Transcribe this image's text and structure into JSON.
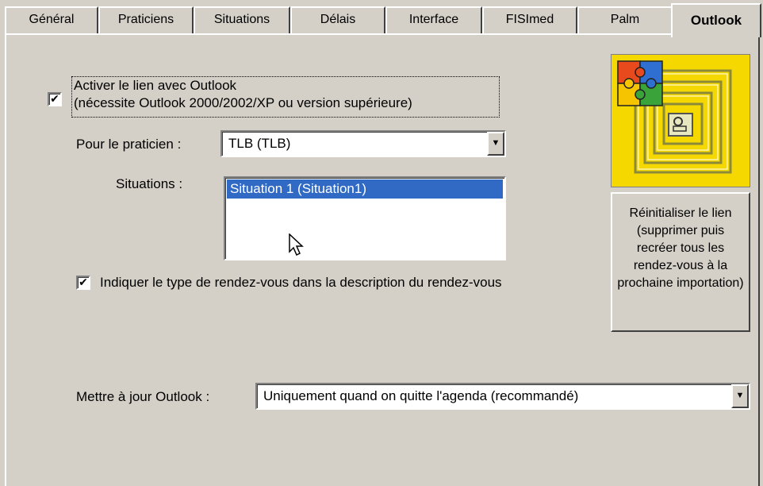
{
  "tabs": [
    {
      "label": "Général"
    },
    {
      "label": "Praticiens"
    },
    {
      "label": "Situations"
    },
    {
      "label": "Délais"
    },
    {
      "label": "Interface"
    },
    {
      "label": "FISImed"
    },
    {
      "label": "Palm"
    },
    {
      "label": "Outlook"
    }
  ],
  "active_tab": "Outlook",
  "outlook_link": {
    "checked": true,
    "check_glyph": "✔",
    "label_line1": "Activer le lien avec Outlook",
    "label_line2": "(nécessite Outlook 2000/2002/XP ou version supérieure)"
  },
  "practitioner": {
    "label": "Pour le praticien :",
    "value": "TLB  (TLB)"
  },
  "situations": {
    "label": "Situations :",
    "items": [
      "Situation 1 (Situation1)"
    ],
    "selected_index": 0
  },
  "appointment_type": {
    "checked": true,
    "check_glyph": "✔",
    "label": "Indiquer le type de rendez-vous dans la description du rendez-vous"
  },
  "reset_button": {
    "label": "Réinitialiser le lien (supprimer puis recréer tous les rendez-vous à la prochaine importation)"
  },
  "update_outlook": {
    "label": "Mettre à jour Outlook :",
    "value": "Uniquement quand on quitte l'agenda (recommandé)"
  },
  "colors": {
    "face": "#d4d0c8",
    "selection": "#316ac5",
    "logo_bg": "#f5d800"
  },
  "icons": {
    "dropdown": "▼",
    "logo": "office-puzzle-icon",
    "cursor": "mouse-pointer-icon"
  }
}
